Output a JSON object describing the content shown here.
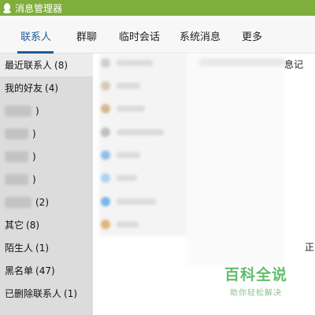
{
  "window": {
    "title": "消息管理器"
  },
  "tabs": [
    {
      "label": "联系人",
      "active": true
    },
    {
      "label": "群聊"
    },
    {
      "label": "临时会话"
    },
    {
      "label": "系统消息"
    },
    {
      "label": "更多"
    }
  ],
  "sidebar": {
    "items": [
      {
        "label": "最近联系人",
        "count": "(8)"
      },
      {
        "label": "我的好友",
        "count": "(4)"
      },
      {
        "label": "",
        "count": ")"
      },
      {
        "label": "",
        "count": ")"
      },
      {
        "label": "",
        "count": ")"
      },
      {
        "label": "",
        "count": ")"
      },
      {
        "label": "",
        "count": "(2)"
      },
      {
        "label": "其它",
        "count": "(8)"
      },
      {
        "label": "陌生人",
        "count": "(1)"
      },
      {
        "label": "黑名单",
        "count": "(47)"
      },
      {
        "label": "已删除联系人",
        "count": "(1)"
      }
    ]
  },
  "main": {
    "column_edge_text": "息记",
    "row_edge_text": "正"
  },
  "watermark": {
    "title": "百科全说",
    "subtitle": "助你轻松解决"
  },
  "colors": {
    "titlebar": "#7fae3d",
    "accent": "#1f5c99",
    "sidebar": "#dcdcdc"
  }
}
